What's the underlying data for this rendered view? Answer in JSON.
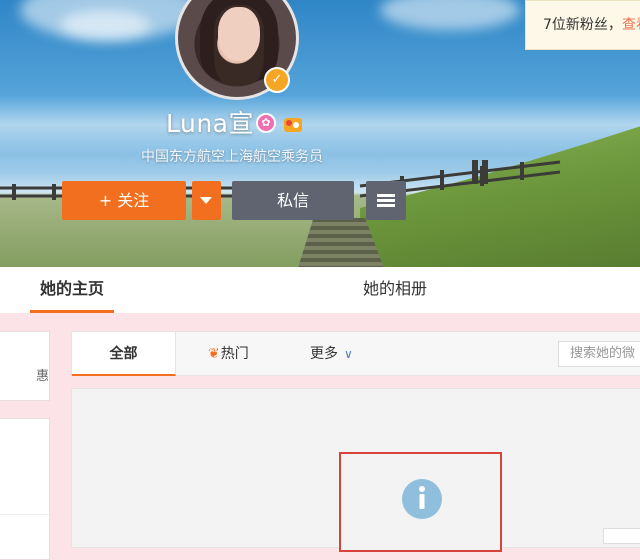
{
  "profile": {
    "username": "Luna宣",
    "subtitle": "中国东方航空上海航空乘务员",
    "icons": [
      "verified-icon",
      "vip-icon",
      "badge-icon"
    ]
  },
  "actions": {
    "follow_label": "+ 关注",
    "message_label": "私信"
  },
  "tabs": {
    "home": "她的主页",
    "album": "她的相册"
  },
  "feed": {
    "filter_all": "全部",
    "filter_hot": "热门",
    "filter_more": "更多",
    "search_placeholder": "搜索她的微"
  },
  "toast": {
    "text": "7位新粉丝，",
    "link": "查看"
  },
  "left": {
    "fragment": "惠"
  },
  "colors": {
    "accent": "#f36f20",
    "button_dark": "#5f6470",
    "highlight_box": "#d9423a",
    "info_icon": "#8fbfdd"
  }
}
